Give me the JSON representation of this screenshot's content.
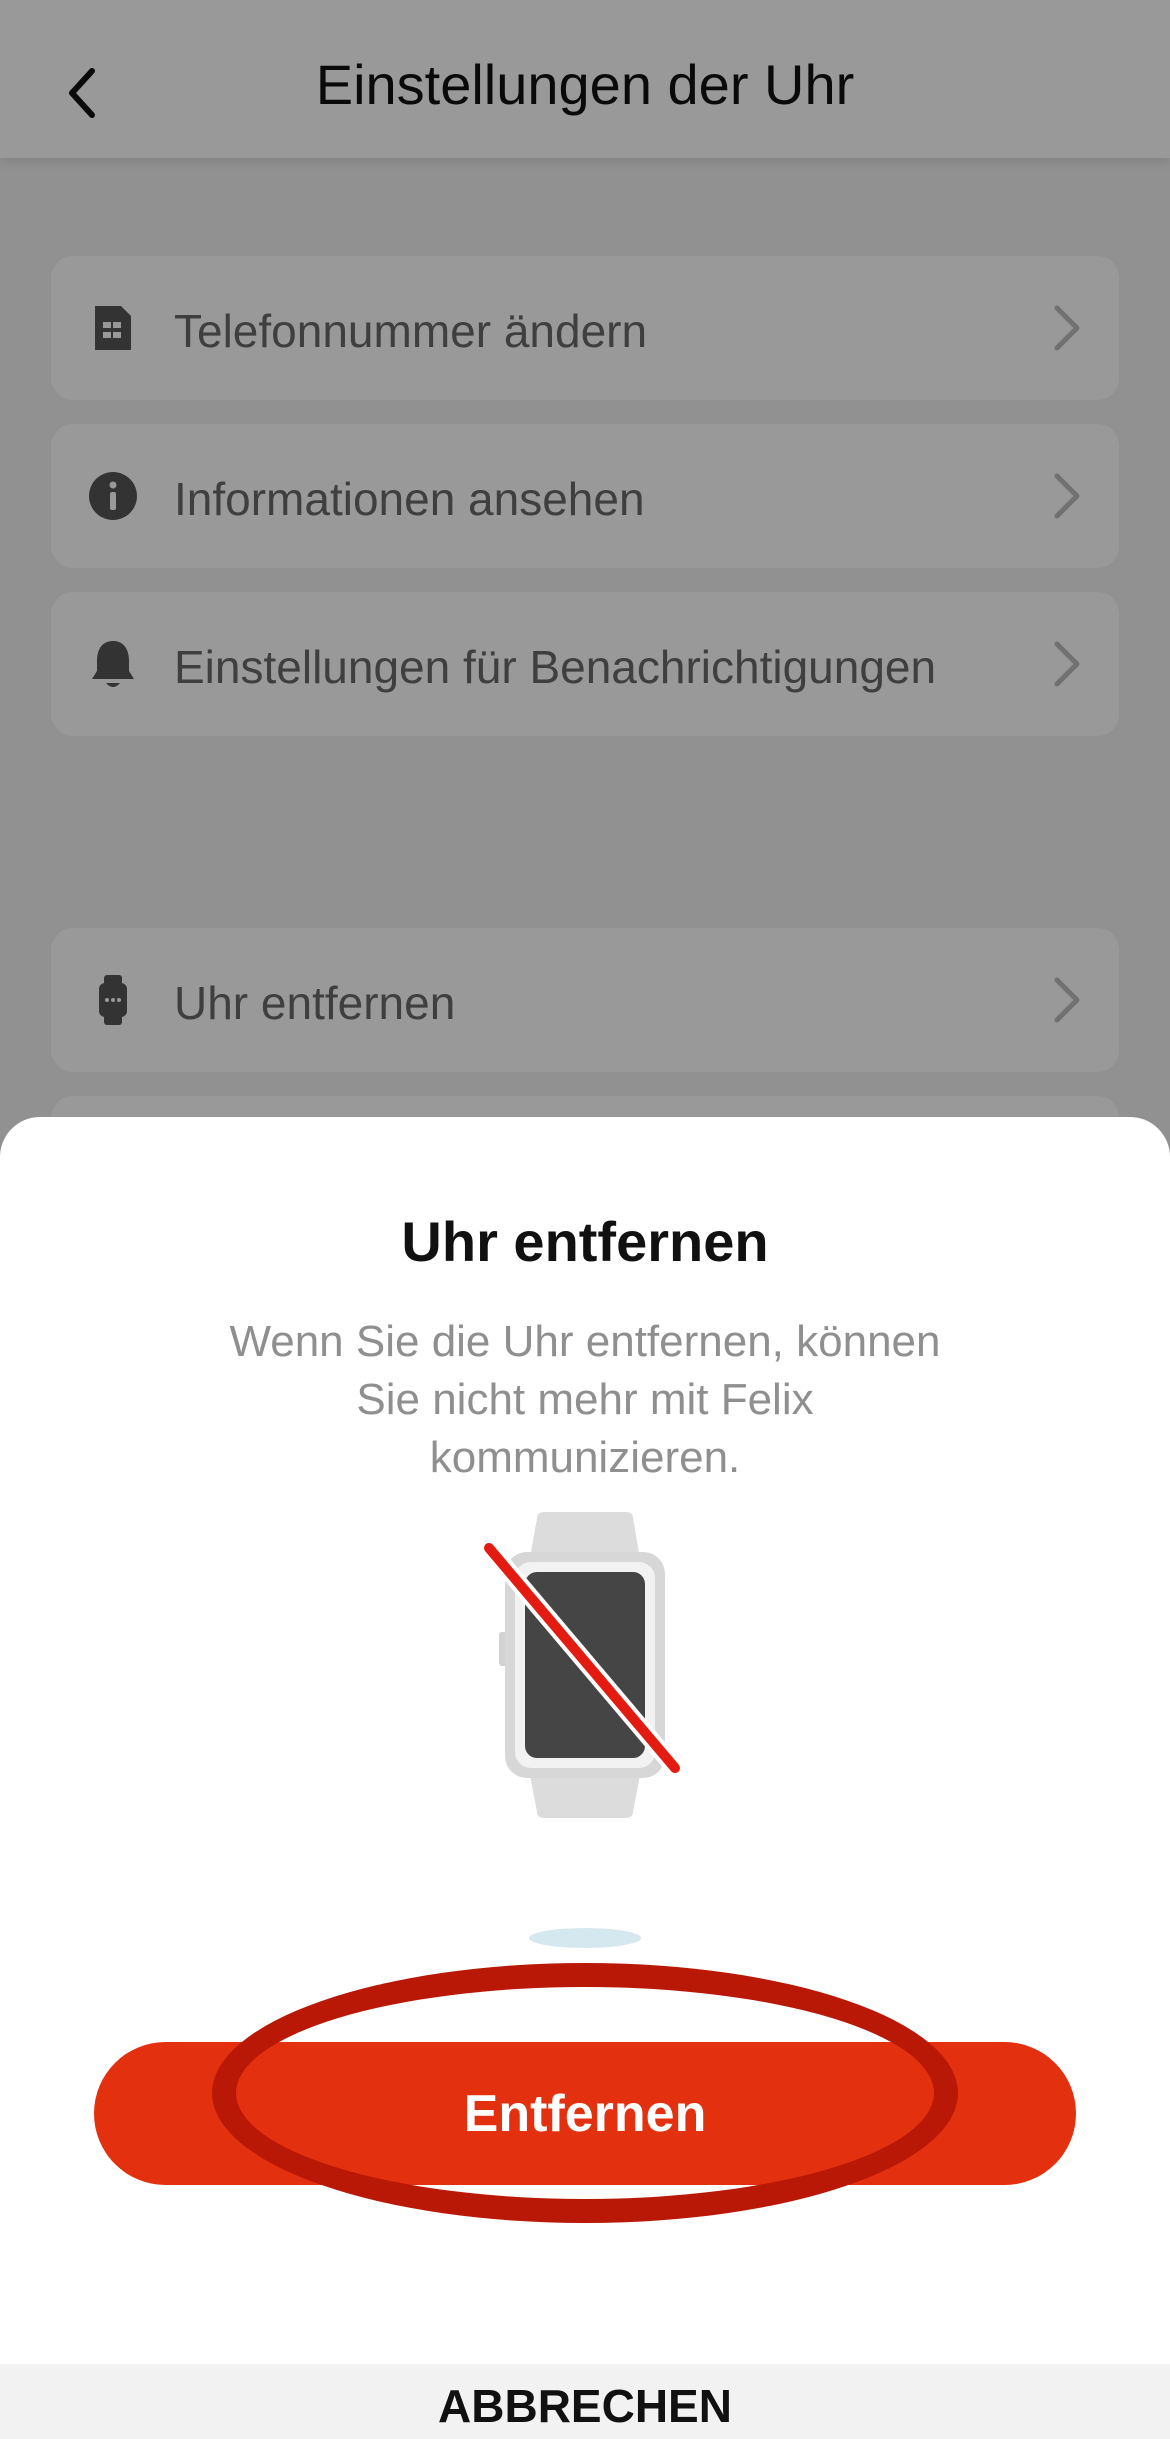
{
  "header": {
    "title": "Einstellungen der Uhr",
    "back_icon": "chevron-left-icon"
  },
  "settings_items": [
    {
      "label": "Telefonnummer ändern",
      "icon": "sim-card-icon"
    },
    {
      "label": "Informationen ansehen",
      "icon": "info-icon"
    },
    {
      "label": "Einstellungen für Benachrichtigungen",
      "icon": "bell-icon"
    },
    {
      "label": "Uhr entfernen",
      "icon": "watch-icon"
    }
  ],
  "dialog": {
    "title": "Uhr entfernen",
    "description": "Wenn Sie die Uhr entfernen, können Sie nicht mehr mit Felix kommunizieren.",
    "illustration": "watch-removed-icon",
    "confirm_label": "Entfernen",
    "cancel_label": "ABBRECHEN"
  },
  "colors": {
    "accent": "#e3300f",
    "annotation": "#b91806",
    "overlay": "rgba(0,0,0,0.40)"
  }
}
